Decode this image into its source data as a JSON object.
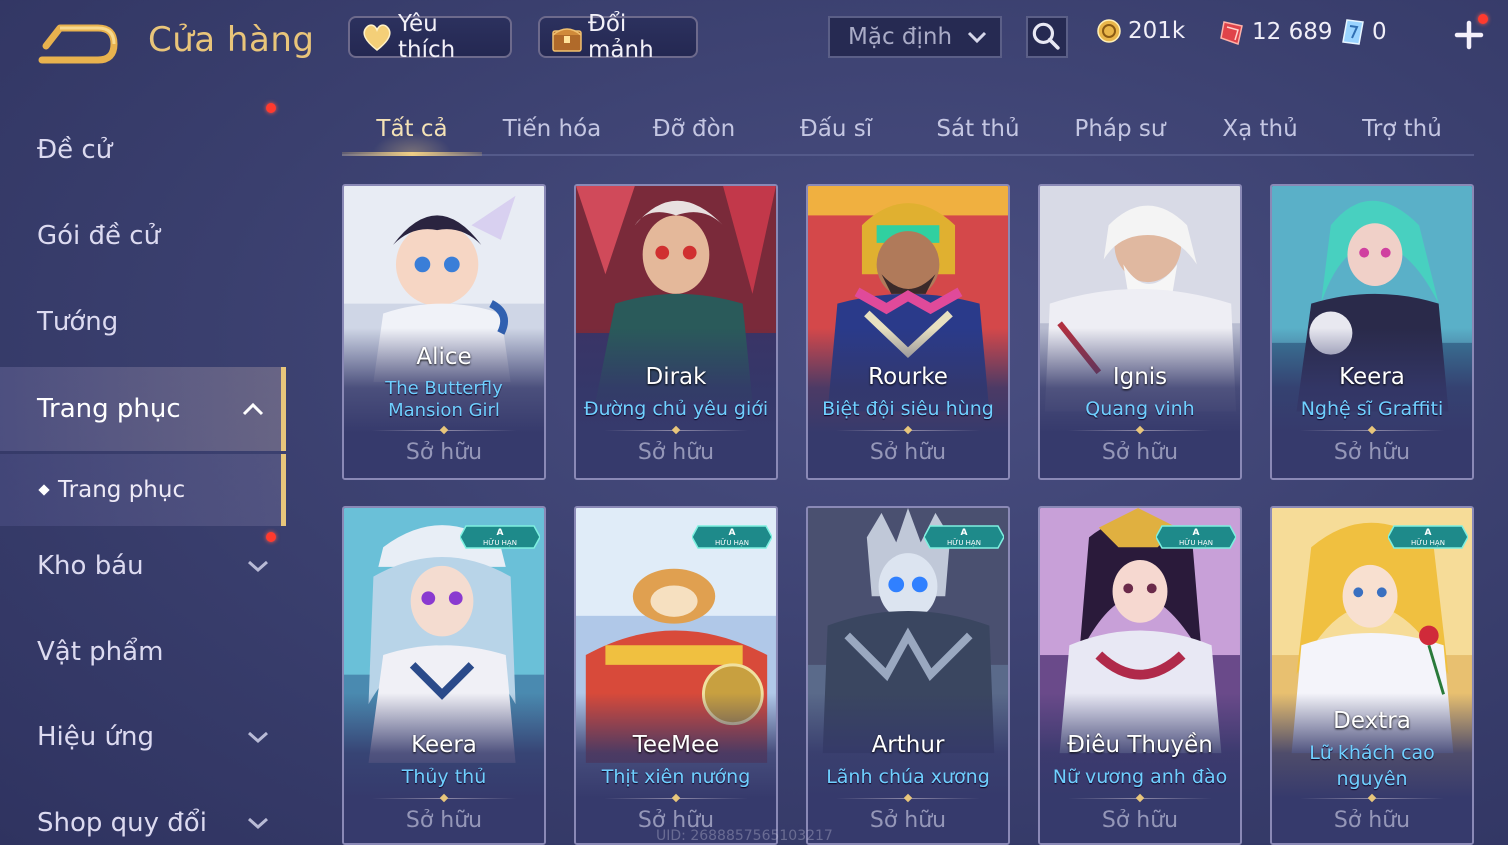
{
  "header": {
    "title": "Cửa hàng",
    "back_icon": "back-arrow-icon",
    "favorites_label": "Yêu thích",
    "exchange_label": "Đổi mảnh",
    "sort": {
      "selected": "Mặc định"
    },
    "currencies": [
      {
        "name": "gold",
        "value": "201k"
      },
      {
        "name": "voucher",
        "value": "12 689"
      },
      {
        "name": "quan-huy",
        "value": "0"
      }
    ]
  },
  "sidebar": {
    "items": [
      {
        "label": "Đề cử"
      },
      {
        "label": "Gói đề cử"
      },
      {
        "label": "Tướng"
      },
      {
        "label": "Trang phục"
      },
      {
        "label": "Trang phục"
      },
      {
        "label": "Kho báu"
      },
      {
        "label": "Vật phẩm"
      },
      {
        "label": "Hiệu ứng"
      },
      {
        "label": "Shop quy đổi"
      }
    ]
  },
  "tabs": [
    "Tất cả",
    "Tiến hóa",
    "Đỡ đòn",
    "Đấu sĩ",
    "Sát thủ",
    "Pháp sư",
    "Xạ thủ",
    "Trợ thủ"
  ],
  "skins": [
    {
      "hero": "Alice",
      "skin": "The Butterfly Mansion Girl",
      "status": "Sở hữu"
    },
    {
      "hero": "Dirak",
      "skin": "Đường chủ yêu giới",
      "status": "Sở hữu"
    },
    {
      "hero": "Rourke",
      "skin": "Biệt đội siêu hùng",
      "status": "Sở hữu"
    },
    {
      "hero": "Ignis",
      "skin": "Quang vinh",
      "status": "Sở hữu"
    },
    {
      "hero": "Keera",
      "skin": "Nghệ sĩ Graffiti",
      "status": "Sở hữu"
    },
    {
      "hero": "Keera",
      "skin": "Thủy thủ",
      "status": "Sở hữu",
      "badge": "HỮU HẠN"
    },
    {
      "hero": "TeeMee",
      "skin": "Thịt xiên nướng",
      "status": "Sở hữu",
      "badge": "HỮU HẠN"
    },
    {
      "hero": "Arthur",
      "skin": "Lãnh chúa xương",
      "status": "Sở hữu",
      "badge": "HỮU HẠN"
    },
    {
      "hero": "Điêu Thuyền",
      "skin": "Nữ vương anh đào",
      "status": "Sở hữu",
      "badge": "HỮU HẠN"
    },
    {
      "hero": "Dextra",
      "skin": "Lữ khách cao nguyên",
      "status": "Sở hữu",
      "badge": "HỮU HẠN"
    }
  ],
  "footer": {
    "uid": "UID: 2688857565103217"
  },
  "colors": {
    "accent_gold": "#e9c57a",
    "skin_name": "#6fd0ff",
    "notify_dot": "#ff3a2e"
  }
}
